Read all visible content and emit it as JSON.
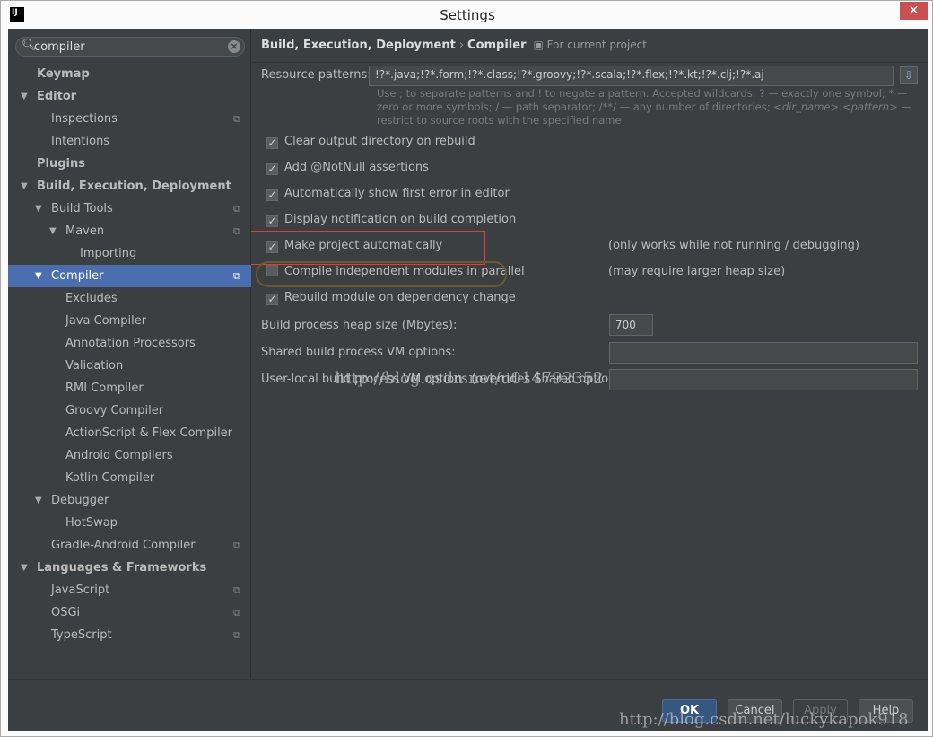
{
  "window": {
    "title": "Settings",
    "app_icon": "IJ",
    "close": "✕"
  },
  "search": {
    "value": "compiler"
  },
  "tree": [
    {
      "label": "Keymap",
      "level": 0,
      "bold": true,
      "arrow": false,
      "copy": false
    },
    {
      "label": "Editor",
      "level": 0,
      "bold": true,
      "arrow": true,
      "copy": false
    },
    {
      "label": "Inspections",
      "level": 1,
      "arrow": false,
      "copy": true
    },
    {
      "label": "Intentions",
      "level": 1,
      "arrow": false,
      "copy": false
    },
    {
      "label": "Plugins",
      "level": 0,
      "bold": true,
      "arrow": false,
      "copy": false
    },
    {
      "label": "Build, Execution, Deployment",
      "level": 0,
      "bold": true,
      "arrow": true,
      "copy": false
    },
    {
      "label": "Build Tools",
      "level": 1,
      "arrow": true,
      "copy": true
    },
    {
      "label": "Maven",
      "level": 2,
      "arrow": true,
      "copy": true
    },
    {
      "label": "Importing",
      "level": 3,
      "arrow": false,
      "copy": false
    },
    {
      "label": "Compiler",
      "level": 1,
      "arrow": true,
      "copy": true,
      "selected": true
    },
    {
      "label": "Excludes",
      "level": 2,
      "arrow": false,
      "copy": false
    },
    {
      "label": "Java Compiler",
      "level": 2,
      "arrow": false,
      "copy": false
    },
    {
      "label": "Annotation Processors",
      "level": 2,
      "arrow": false,
      "copy": false
    },
    {
      "label": "Validation",
      "level": 2,
      "arrow": false,
      "copy": false
    },
    {
      "label": "RMI Compiler",
      "level": 2,
      "arrow": false,
      "copy": false
    },
    {
      "label": "Groovy Compiler",
      "level": 2,
      "arrow": false,
      "copy": false
    },
    {
      "label": "ActionScript & Flex Compiler",
      "level": 2,
      "arrow": false,
      "copy": false
    },
    {
      "label": "Android Compilers",
      "level": 2,
      "arrow": false,
      "copy": false
    },
    {
      "label": "Kotlin Compiler",
      "level": 2,
      "arrow": false,
      "copy": false
    },
    {
      "label": "Debugger",
      "level": 1,
      "arrow": true,
      "copy": false
    },
    {
      "label": "HotSwap",
      "level": 2,
      "arrow": false,
      "copy": false
    },
    {
      "label": "Gradle-Android Compiler",
      "level": 1,
      "arrow": false,
      "copy": true
    },
    {
      "label": "Languages & Frameworks",
      "level": 0,
      "bold": true,
      "arrow": true,
      "copy": false
    },
    {
      "label": "JavaScript",
      "level": 1,
      "arrow": false,
      "copy": true
    },
    {
      "label": "OSGi",
      "level": 1,
      "arrow": false,
      "copy": true
    },
    {
      "label": "TypeScript",
      "level": 1,
      "arrow": false,
      "copy": true
    }
  ],
  "header": {
    "crumb1": "Build, Execution, Deployment",
    "sep": "›",
    "crumb2": "Compiler",
    "scope": "For current project"
  },
  "resource": {
    "label": "Resource patterns:",
    "value": "!?*.java;!?*.form;!?*.class;!?*.groovy;!?*.scala;!?*.flex;!?*.kt;!?*.clj;!?*.aj",
    "hint1": "Use ; to separate patterns and ! to negate a pattern. Accepted wildcards: ? — exactly one symbol; * — zero or more symbols; / — path separator; /**/ — any number of directories; ",
    "hint_dir": "<dir_name>:<pattern>",
    "hint2": " — restrict to source roots with the specified name"
  },
  "options": [
    {
      "label": "Clear output directory on rebuild",
      "checked": true,
      "note": ""
    },
    {
      "label": "Add @NotNull assertions",
      "checked": true,
      "note": ""
    },
    {
      "label": "Automatically show first error in editor",
      "checked": true,
      "note": ""
    },
    {
      "label": "Display notification on build completion",
      "checked": true,
      "note": ""
    },
    {
      "label": "Make project automatically",
      "checked": true,
      "note": "(only works while not running / debugging)"
    },
    {
      "label": "Compile independent modules in parallel",
      "checked": false,
      "note": "(may require larger heap size)"
    },
    {
      "label": "Rebuild module on dependency change",
      "checked": true,
      "note": ""
    }
  ],
  "heap": {
    "label": "Build process heap size (Mbytes):",
    "value": "700"
  },
  "shared_vm": {
    "label": "Shared build process VM options:",
    "value": ""
  },
  "user_vm": {
    "label": "User-local build process VM options (overrides Shared options):",
    "value": ""
  },
  "buttons": {
    "ok": "OK",
    "cancel": "Cancel",
    "apply": "Apply",
    "help": "Help"
  },
  "watermarks": {
    "mid": "http://blog.csdn.net/u014792352",
    "bottom": "http://blog.csdn.net/luckykapok918"
  },
  "colors": {
    "selection": "#4b6eaf",
    "background": "#3c3f41",
    "highlight_box": "#e23b3b"
  }
}
